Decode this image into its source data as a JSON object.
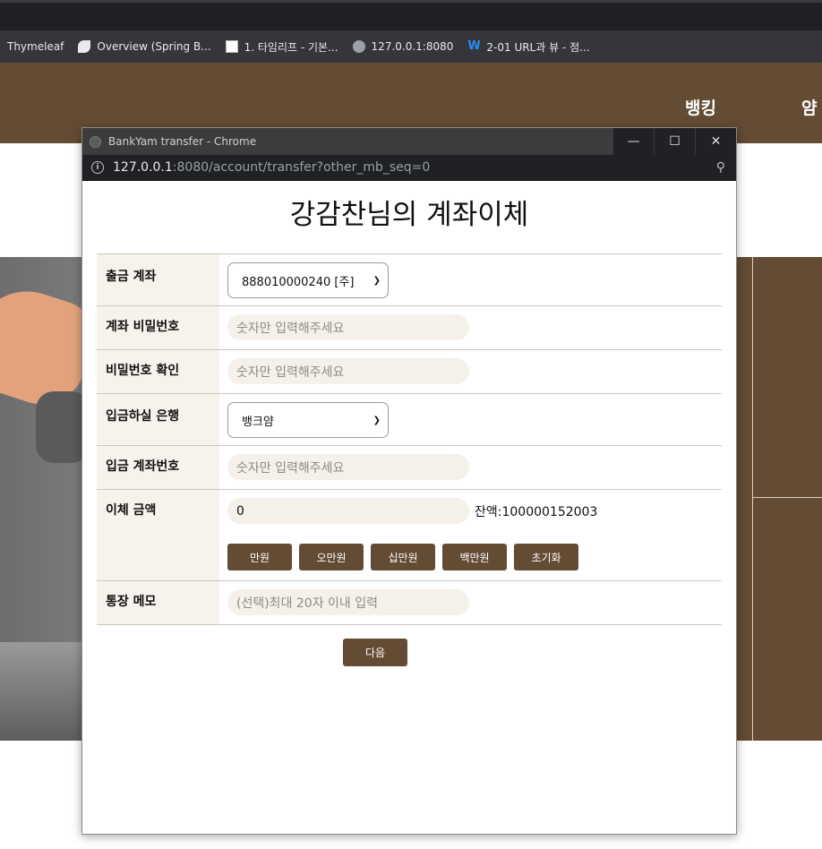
{
  "bookmarks": [
    {
      "label": "Thymeleaf",
      "icon": "none"
    },
    {
      "label": "Overview (Spring B...",
      "icon": "leaf-icon"
    },
    {
      "label": "1. 타임리프 - 기본...",
      "icon": "page-icon"
    },
    {
      "label": "127.0.0.1:8080",
      "icon": "globe-icon"
    },
    {
      "label": "2-01 URL과 뷰 - 점...",
      "icon": "w-icon"
    }
  ],
  "site": {
    "nav_banking": "뱅킹",
    "nav_partial": "얌"
  },
  "popup": {
    "window_title": "BankYam transfer - Chrome",
    "url_host": "127.0.0.1",
    "url_rest": ":8080/account/transfer?other_mb_seq=0",
    "page_title": "강감찬님의 계좌이체",
    "rows": {
      "out_account_label": "출금 계좌",
      "out_account_value": "888010000240 [주]",
      "password_label": "계좌 비밀번호",
      "password_placeholder": "숫자만 입력해주세요",
      "password_confirm_label": "비밀번호 확인",
      "password_confirm_placeholder": "숫자만 입력해주세요",
      "bank_label": "입금하실 은행",
      "bank_value": "뱅크얌",
      "deposit_account_label": "입금 계좌번호",
      "deposit_account_placeholder": "숫자만 입력해주세요",
      "amount_label": "이체 금액",
      "amount_value": "0",
      "balance_text": "잔액:100000152003",
      "amount_buttons": [
        "만원",
        "오만원",
        "십만원",
        "백만원",
        "초기화"
      ],
      "memo_label": "통장 메모",
      "memo_placeholder": "(선택)최대 20자 이내 입력"
    },
    "next_button": "다음"
  },
  "colors": {
    "brand_brown": "#644b33",
    "label_bg": "#f6f2ec",
    "input_bg": "#f5f1ea"
  }
}
